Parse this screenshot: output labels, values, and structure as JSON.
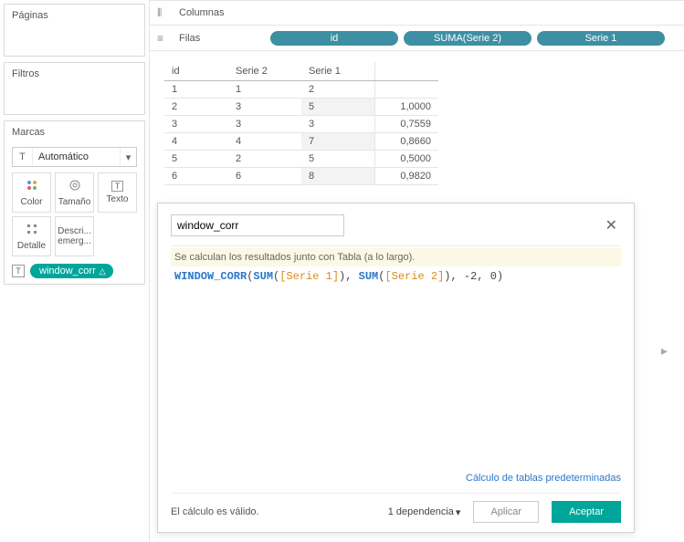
{
  "left": {
    "pages_title": "Páginas",
    "filters_title": "Filtros",
    "marks_title": "Marcas",
    "mark_type": "Automático",
    "buttons": {
      "color": "Color",
      "size": "Tamaño",
      "text": "Texto",
      "detail": "Detalle",
      "tooltip": "Descri... emerg..."
    },
    "calc_pill": "window_corr",
    "calc_pill_tri": "△"
  },
  "shelves": {
    "columns_label": "Columnas",
    "rows_label": "Filas",
    "row_pills": [
      "id",
      "SUMA(Serie 2)",
      "Serie 1"
    ]
  },
  "table": {
    "headers": {
      "id": "id",
      "s2": "Serie 2",
      "s1": "Serie 1"
    },
    "rows": [
      {
        "id": "1",
        "s2": "1",
        "s1": "2",
        "val": ""
      },
      {
        "id": "2",
        "s2": "3",
        "s1": "5",
        "val": "1,0000"
      },
      {
        "id": "3",
        "s2": "3",
        "s1": "3",
        "val": "0,7559"
      },
      {
        "id": "4",
        "s2": "4",
        "s1": "7",
        "val": "0,8660"
      },
      {
        "id": "5",
        "s2": "2",
        "s1": "5",
        "val": "0,5000"
      },
      {
        "id": "6",
        "s2": "6",
        "s1": "8",
        "val": "0,9820"
      }
    ]
  },
  "calc": {
    "name": "window_corr",
    "msg": "Se calculan los resultados junto con Tabla (a lo largo).",
    "code": {
      "fn": "WINDOW_CORR",
      "open": "(",
      "sum1": "SUM",
      "p1o": "(",
      "f1": "[Serie 1]",
      "p1c": ")",
      "sep1": ", ",
      "sum2": "SUM",
      "p2o": "(",
      "f2": "[Serie 2]",
      "p2c": ")",
      "rest": ", -2, 0)"
    },
    "link": "Cálculo de tablas predeterminadas",
    "valid": "El cálculo es válido.",
    "deps": "1 dependencia",
    "apply": "Aplicar",
    "accept": "Aceptar"
  },
  "chart_data": {
    "type": "table",
    "columns": [
      "id",
      "Serie 2",
      "Serie 1",
      "window_corr"
    ],
    "rows": [
      [
        1,
        1,
        2,
        null
      ],
      [
        2,
        3,
        5,
        1.0
      ],
      [
        3,
        3,
        3,
        0.7559
      ],
      [
        4,
        4,
        7,
        0.866
      ],
      [
        5,
        2,
        5,
        0.5
      ],
      [
        6,
        6,
        8,
        0.982
      ]
    ]
  }
}
